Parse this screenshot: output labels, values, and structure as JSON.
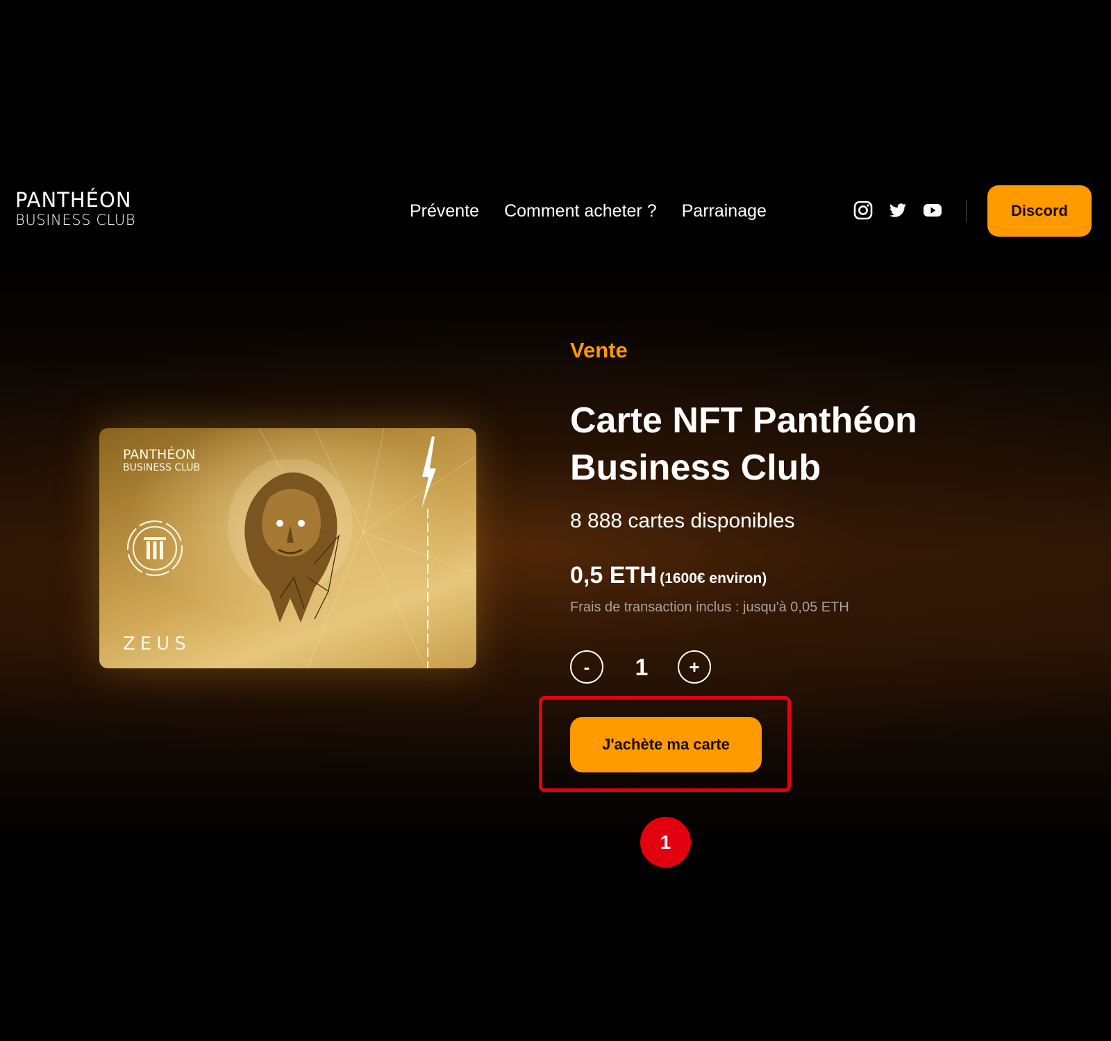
{
  "header": {
    "logo": {
      "top": "PANTHÉON",
      "bottom": "BUSINESS CLUB"
    },
    "nav": [
      {
        "label": "Prévente"
      },
      {
        "label": "Comment acheter ?"
      },
      {
        "label": "Parrainage"
      }
    ],
    "social_icons": [
      "instagram-icon",
      "twitter-icon",
      "youtube-icon"
    ],
    "discord_label": "Discord"
  },
  "card": {
    "logo_top": "PANTHÉON",
    "logo_bottom": "BUSINESS CLUB",
    "name": "ZEUS"
  },
  "product": {
    "eyebrow": "Vente",
    "title": "Carte NFT Panthéon Business Club",
    "availability": "8 888 cartes disponibles",
    "price": "0,5 ETH",
    "price_note": "(1600€ environ)",
    "fees": "Frais de transaction inclus : jusqu'à 0,05 ETH",
    "quantity": {
      "minus_label": "-",
      "value": "1",
      "plus_label": "+"
    },
    "buy_label": "J'achète ma carte"
  },
  "annotation": {
    "step": "1"
  },
  "colors": {
    "accent": "#ff9a00",
    "highlight": "#e3000f",
    "background": "#000000",
    "muted_text": "#a8a3a0"
  }
}
